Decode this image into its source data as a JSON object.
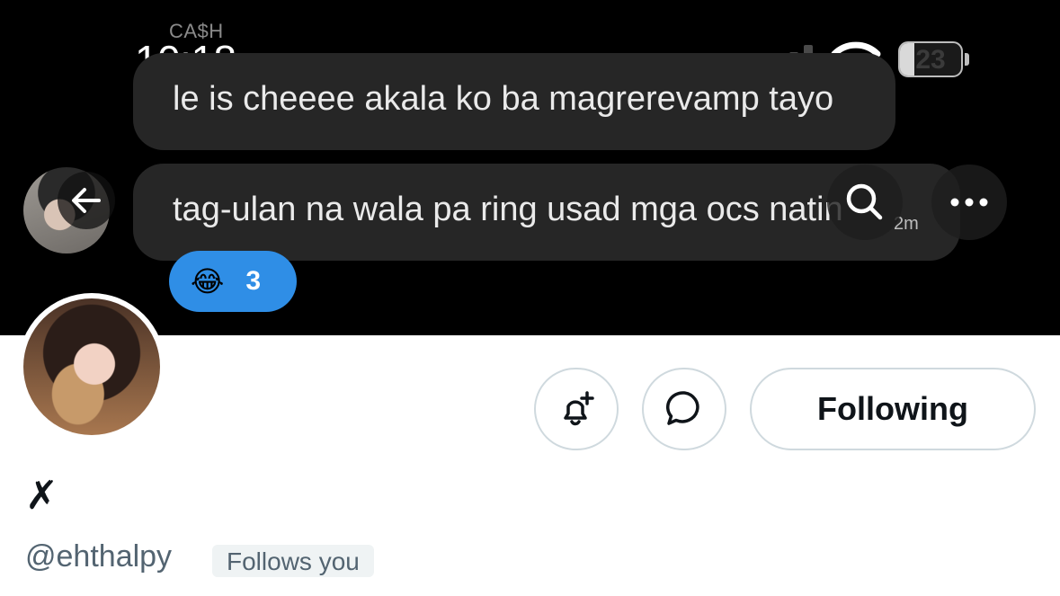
{
  "status_bar": {
    "carrier": "CA$H",
    "time": "10:18",
    "battery_level": "23",
    "signal_bars_active": 2,
    "signal_bars_total": 4
  },
  "banner": {
    "messages": [
      {
        "text": "le is cheeee akala ko ba magrerevamp tayo"
      },
      {
        "text": "tag-ulan na wala pa ring usad mga ocs natin",
        "time": "2m"
      }
    ],
    "reaction": {
      "emoji": "😂",
      "count": "3"
    }
  },
  "profile": {
    "display_name": "✗",
    "handle": "@ehthalpy",
    "follows_you_label": "Follows you",
    "following_label": "Following"
  },
  "icons": [
    "back-arrow-icon",
    "search-icon",
    "more-icon",
    "notification-add-icon",
    "message-icon",
    "wifi-icon",
    "signal-icon",
    "battery-icon"
  ],
  "colors": {
    "banner_bg": "#000000",
    "bubble_bg": "#262626",
    "reaction_bg": "#2f8ee6",
    "text_primary": "#0f1419",
    "text_secondary": "#536471",
    "button_border": "#cfd9de"
  }
}
